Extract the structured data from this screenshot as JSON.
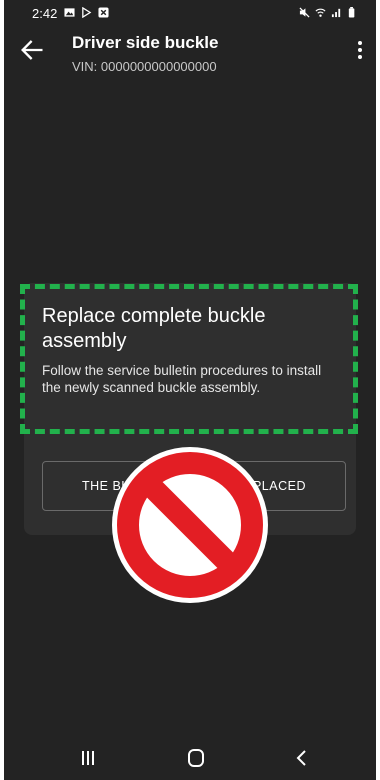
{
  "status_bar": {
    "time": "2:42",
    "left_icons": [
      "image-icon",
      "play-store-icon",
      "close-box-icon"
    ],
    "right_icons": [
      "mute-icon",
      "wifi-icon",
      "signal-icon",
      "battery-icon"
    ]
  },
  "app_bar": {
    "title": "Driver side buckle",
    "subtitle": "VIN: 0000000000000000"
  },
  "card": {
    "title": "Replace complete buckle assembly",
    "body": "Follow the service bulletin procedures to install the newly scanned buckle assembly.",
    "button_label": "THE BUCKLE WAS NOT REPLACED"
  },
  "overlay": {
    "highlight_color": "#22b14c",
    "prohibition_color": "#e31e24"
  },
  "nav_bar": {
    "items": [
      "recent-apps-icon",
      "home-icon",
      "back-icon"
    ]
  }
}
